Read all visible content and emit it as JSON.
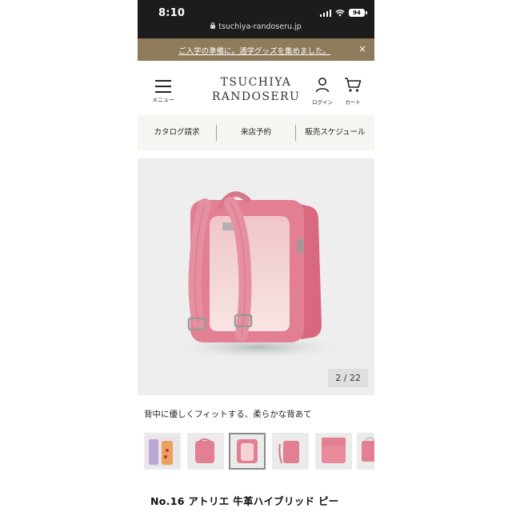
{
  "status": {
    "time": "8:10",
    "battery": "94"
  },
  "browser": {
    "url": "tsuchiya-randoseru.jp"
  },
  "announcement": {
    "text": "ご入学の準備に。通学グッズを集めました。",
    "close": "×"
  },
  "header": {
    "menu_label": "メニュー",
    "logo_line1": "TSUCHIYA",
    "logo_line2": "RANDOSERU",
    "login_label": "ログイン",
    "cart_label": "カート"
  },
  "nav": {
    "items": [
      {
        "label": "カタログ請求"
      },
      {
        "label": "来店予約"
      },
      {
        "label": "販売スケジュール"
      }
    ]
  },
  "gallery": {
    "counter": "2 / 22",
    "caption": "背中に優しくフィットする、柔らかな背あて",
    "thumbnails": [
      {
        "icon": "thumbnail-accessories"
      },
      {
        "icon": "thumbnail-backpack-front"
      },
      {
        "icon": "thumbnail-backpack-back",
        "selected": true
      },
      {
        "icon": "thumbnail-backpack-side"
      },
      {
        "icon": "thumbnail-backpack-open"
      },
      {
        "icon": "thumbnail-backpack-detail"
      }
    ]
  },
  "product": {
    "title": "No.16 アトリエ 牛革ハイブリッド ピー"
  },
  "colors": {
    "announcement_bg": "#8e7b5b",
    "status_bg": "#1c1c1c",
    "backpack_pink": "#e27f93",
    "nav_bg": "#f6f5f2"
  }
}
